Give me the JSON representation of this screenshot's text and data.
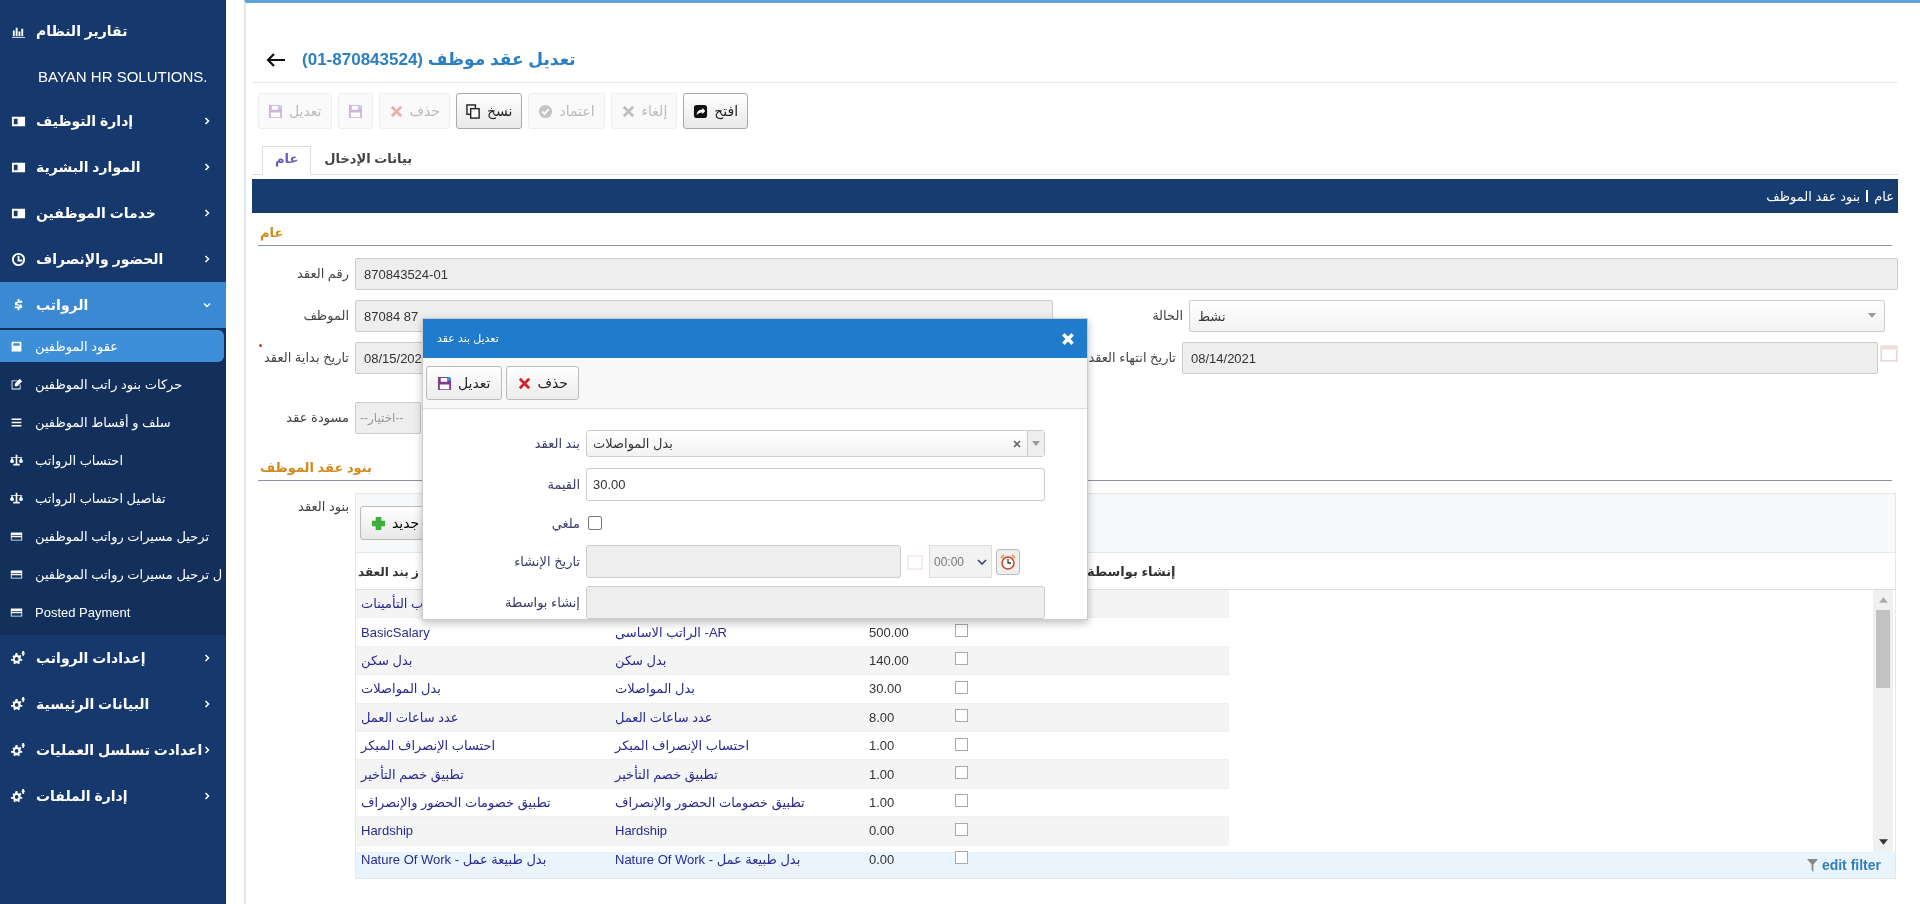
{
  "sidebar": {
    "items": [
      {
        "kind": "link",
        "label": "تقارير النظام"
      },
      {
        "kind": "brand",
        "label": "BAYAN HR SOLUTIONS."
      },
      {
        "kind": "group",
        "label": "إدارة التوظيف",
        "expanded": false
      },
      {
        "kind": "group",
        "label": "الموارد البشرية",
        "expanded": false
      },
      {
        "kind": "group",
        "label": "خدمات الموظفين",
        "expanded": false
      },
      {
        "kind": "group",
        "label": "الحضور والإنصراف",
        "expanded": false
      },
      {
        "kind": "group",
        "label": "الرواتب",
        "expanded": true,
        "children": [
          {
            "label": "عقود الموظفين",
            "selected": true
          },
          {
            "label": "حركات بنود راتب الموظفين",
            "selected": false
          },
          {
            "label": "سلف و أقساط الموظفين",
            "selected": false
          },
          {
            "label": "احتساب الرواتب",
            "selected": false
          },
          {
            "label": "تفاصيل احتساب الرواتب",
            "selected": false
          },
          {
            "label": "ترحيل مسيرات رواتب الموظفين",
            "selected": false
          },
          {
            "label": "ل ترحيل مسيرات رواتب الموظفين",
            "selected": false
          },
          {
            "label": "Posted Payment",
            "selected": false
          }
        ]
      },
      {
        "kind": "group",
        "label": "إعدادات الرواتب",
        "expanded": false
      },
      {
        "kind": "group",
        "label": "البيانات الرئيسية",
        "expanded": false
      },
      {
        "kind": "group",
        "label": "اعدادت تسلسل العمليات",
        "expanded": false
      },
      {
        "kind": "group",
        "label": "إدارة الملفات",
        "expanded": false
      }
    ]
  },
  "page": {
    "title": "تعديل عقد موظف (870843524-01)"
  },
  "toolbar": [
    {
      "kind": "open",
      "label": "افتح",
      "disabled": false
    },
    {
      "kind": "cancel",
      "label": "إلغاء",
      "disabled": true
    },
    {
      "kind": "approve",
      "label": "اعتماد",
      "disabled": true
    },
    {
      "kind": "copy",
      "label": "نسخ",
      "disabled": false
    },
    {
      "kind": "delete",
      "label": "حذف",
      "disabled": true
    },
    {
      "kind": "save-icon",
      "disabled": true
    },
    {
      "kind": "save",
      "label": "تعديل",
      "disabled": true
    }
  ],
  "tabs": [
    {
      "label": "بيانات الإدخال",
      "selected": false
    },
    {
      "label": "عام",
      "selected": true
    }
  ],
  "breadcrumb": [
    "عام",
    "بنود عقد الموظف"
  ],
  "section_general": {
    "title": "عام",
    "contract_number": {
      "label": "رقم العقد",
      "value": "870843524-01"
    },
    "employee": {
      "label": "الموظف",
      "value": "87084 87"
    },
    "status": {
      "label": "الحالة",
      "value": "نشط"
    },
    "start_date": {
      "label": "تاريخ بداية العقد",
      "value": "08/15/202",
      "required": true
    },
    "end_date": {
      "label": "تاريخ انتهاء العقد",
      "value": "08/14/2021"
    },
    "draft": {
      "label": "مسودة عقد",
      "placeholder": "--اختيار--"
    }
  },
  "section_items": {
    "title": "بنود عقد الموظف",
    "grid_label": "بنود العقد",
    "new_button": "جديد",
    "columns": [
      "إنشاء بواسطة",
      "ز بند العقد"
    ],
    "rows": [
      {
        "code": "ب التأمينات"
      },
      {
        "code": "BasicSalary",
        "name": "الراتب الاساسى -AR",
        "value": "500.00",
        "cancelled": false
      },
      {
        "code": "بدل سكن",
        "name": "بدل سكن",
        "value": "140.00",
        "cancelled": false
      },
      {
        "code": "بدل المواصلات",
        "name": "بدل المواصلات",
        "value": "30.00",
        "cancelled": false
      },
      {
        "code": "عدد ساعات العمل",
        "name": "عدد ساعات العمل",
        "value": "8.00",
        "cancelled": false
      },
      {
        "code": "احتساب الإنصراف المبكر",
        "name": "احتساب الإنصراف المبكر",
        "value": "1.00",
        "cancelled": false
      },
      {
        "code": "تطبيق خصم التأخير",
        "name": "تطبيق خصم التأخير",
        "value": "1.00",
        "cancelled": false
      },
      {
        "code": "تطبيق خصومات الحضور والإنصراف",
        "name": "تطبيق خصومات الحضور والإنصراف",
        "value": "1.00",
        "cancelled": false
      },
      {
        "code": "Hardship",
        "name": "Hardship",
        "value": "0.00",
        "cancelled": false
      },
      {
        "code": "Nature Of Work - بدل طبيعة عمل",
        "name": "Nature Of Work - بدل طبيعة عمل",
        "value": "0.00",
        "cancelled": false
      }
    ],
    "footer_link": "edit filter"
  },
  "dialog": {
    "title": "تعديل بند عقد",
    "buttons": [
      {
        "kind": "delete",
        "label": "حذف"
      },
      {
        "kind": "save",
        "label": "تعديل"
      }
    ],
    "item": {
      "label": "بند العقد",
      "value": "بدل المواصلات"
    },
    "amount": {
      "label": "القيمة",
      "value": "30.00"
    },
    "cancelled": {
      "label": "ملغي",
      "checked": false
    },
    "created_at": {
      "label": "تاريخ الإنشاء",
      "time": "00:00"
    },
    "created_by": {
      "label": "إنشاء بواسطة"
    }
  }
}
